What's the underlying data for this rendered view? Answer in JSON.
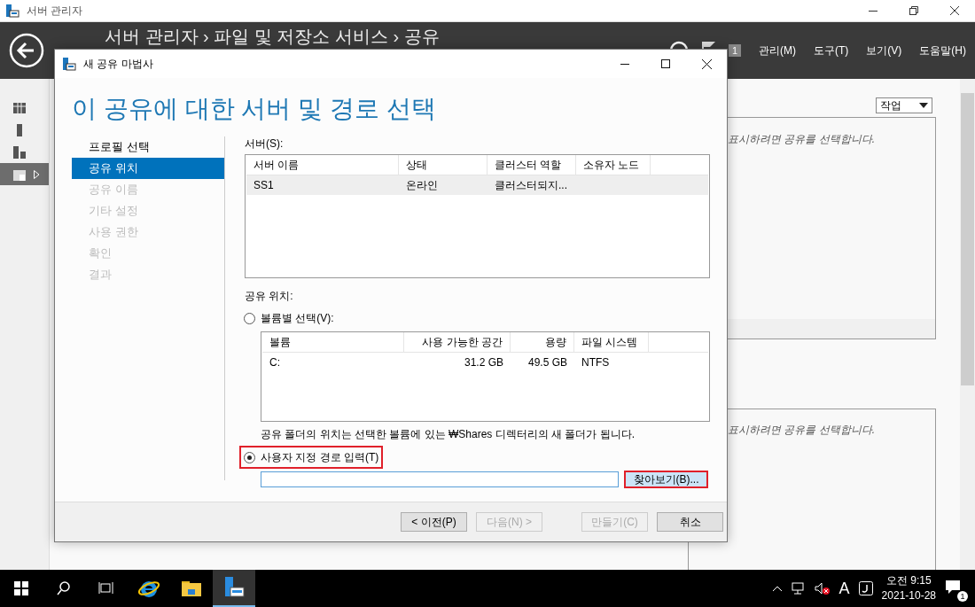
{
  "window": {
    "title": "서버 관리자"
  },
  "header": {
    "breadcrumb": "서버 관리자 › 파일 및 저장소 서비스 › 공유",
    "notification_count": "1",
    "menu": [
      "관리(M)",
      "도구(T)",
      "보기(V)",
      "도움말(H)"
    ]
  },
  "nav": [
    {
      "selected": false
    },
    {
      "selected": false
    },
    {
      "selected": false
    },
    {
      "selected": true
    }
  ],
  "tasks_button": "작업",
  "panels": [
    {
      "hint": "표시하려면 공유를 선택합니다."
    },
    {
      "hint": "표시하려면 공유를 선택합니다."
    }
  ],
  "dialog": {
    "title": "새 공유 마법사",
    "heading": "이 공유에 대한 서버 및 경로 선택",
    "steps": [
      {
        "label": "프로필 선택",
        "selected": false,
        "disabled": false
      },
      {
        "label": "공유 위치",
        "selected": true,
        "disabled": false
      },
      {
        "label": "공유 이름",
        "selected": false,
        "disabled": true
      },
      {
        "label": "기타 설정",
        "selected": false,
        "disabled": true
      },
      {
        "label": "사용 권한",
        "selected": false,
        "disabled": true
      },
      {
        "label": "확인",
        "selected": false,
        "disabled": true
      },
      {
        "label": "결과",
        "selected": false,
        "disabled": true
      }
    ],
    "server_label": "서버(S):",
    "server_table": {
      "columns": [
        "서버 이름",
        "상태",
        "클러스터 역할",
        "소유자 노드"
      ],
      "rows": [
        {
          "cells": [
            "SS1",
            "온라인",
            "클러스터되지..."
          ],
          "selected": true
        }
      ]
    },
    "location_label": "공유 위치:",
    "options": [
      {
        "label": "볼륨별 선택(V):",
        "selected": false,
        "highlighted": false
      },
      {
        "label": "사용자 지정 경로 입력(T)",
        "selected": true,
        "highlighted": true
      }
    ],
    "volume_table": {
      "columns": [
        "볼륨",
        "사용 가능한 공간",
        "용량",
        "파일 시스템"
      ],
      "rows": [
        {
          "cells": [
            "C:",
            "31.2 GB",
            "49.5 GB",
            "NTFS"
          ]
        }
      ]
    },
    "note": "공유 폴더의 위치는 선택한 볼륨에 있는 ₩Shares 디렉터리의 새 폴더가 됩니다.",
    "browse_button": {
      "label": "찾아보기(B)...",
      "highlighted": true
    },
    "buttons": [
      {
        "label": "< 이전(P)",
        "disabled": false
      },
      {
        "label": "다음(N) >",
        "disabled": true
      },
      {
        "label": "만들기(C)",
        "disabled": true
      },
      {
        "label": "취소",
        "disabled": false
      }
    ]
  },
  "taskbar": {
    "apps": [
      {
        "kind": "search",
        "selected": false
      },
      {
        "kind": "taskview",
        "selected": false
      },
      {
        "kind": "browser",
        "selected": false
      },
      {
        "kind": "explorer",
        "selected": false
      },
      {
        "kind": "server",
        "selected": true
      }
    ],
    "ime": "A",
    "time": "오전 9:15",
    "date": "2021-10-28",
    "notification_count": "1"
  }
}
